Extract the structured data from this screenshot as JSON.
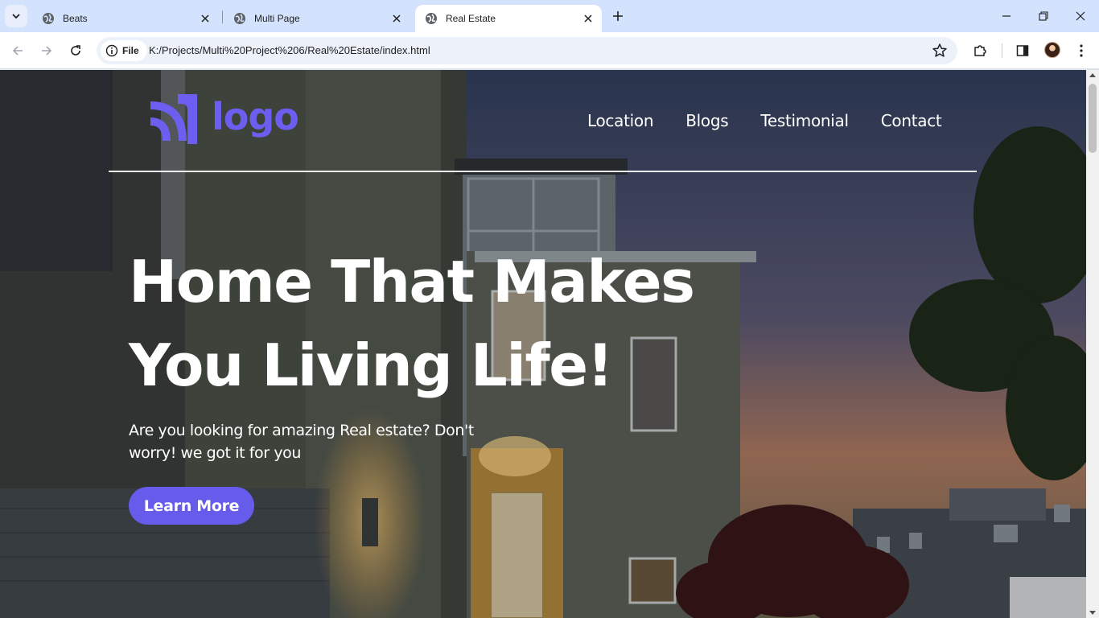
{
  "browser": {
    "tabs": [
      {
        "title": "Beats",
        "active": false
      },
      {
        "title": "Multi Page",
        "active": false
      },
      {
        "title": "Real Estate",
        "active": true
      }
    ],
    "security_chip": "File",
    "url": "K:/Projects/Multi%20Project%206/Real%20Estate/index.html"
  },
  "site": {
    "logo_text": "logo",
    "brand_color": "#6c5ff0",
    "nav": [
      {
        "label": "Location"
      },
      {
        "label": "Blogs"
      },
      {
        "label": "Testimonial"
      },
      {
        "label": "Contact"
      }
    ],
    "hero": {
      "title_line1": "Home That Makes",
      "title_line2": "You Living Life!",
      "subtitle": "Are you looking for amazing Real estate? Don't worry! we got it for you",
      "cta_label": "Learn More"
    }
  }
}
